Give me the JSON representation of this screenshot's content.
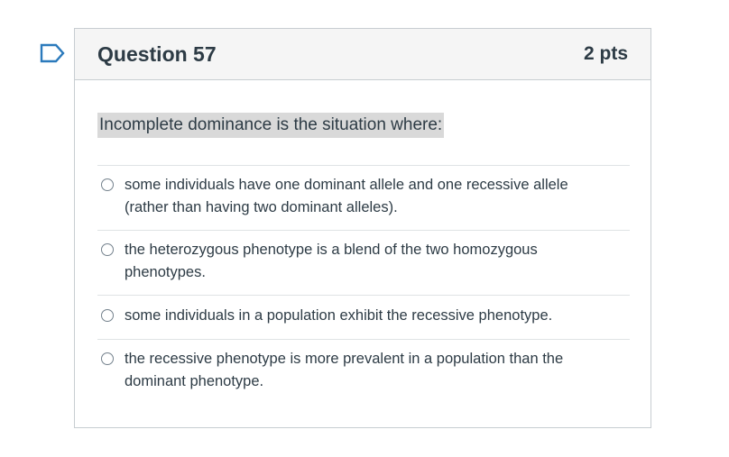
{
  "question": {
    "title": "Question 57",
    "points": "2 pts",
    "prompt": "Incomplete dominance is the situation where:",
    "flag_icon": "bookmark-flag-icon",
    "answers": [
      {
        "text": "some individuals have one dominant allele and one recessive allele (rather than having two dominant alleles)."
      },
      {
        "text": "the heterozygous phenotype is a blend of the two homozygous phenotypes."
      },
      {
        "text": "some individuals in a population exhibit the recessive phenotype."
      },
      {
        "text": "the recessive phenotype is more prevalent in a population than the dominant phenotype."
      }
    ]
  },
  "colors": {
    "flag": "#2b7abc",
    "header_bg": "#f5f5f5",
    "border": "#c7cdd1",
    "text": "#2d3b45",
    "highlight": "#d9d9d9"
  }
}
